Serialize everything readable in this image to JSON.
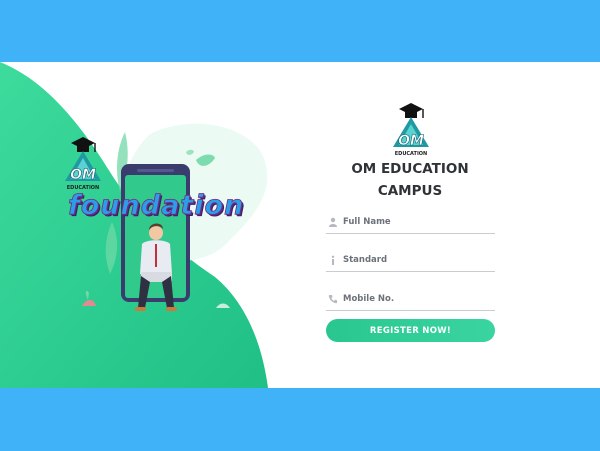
{
  "brand": {
    "logo_text": "OM",
    "logo_subtext": "EDUCATION",
    "title_line1": "OM EDUCATION",
    "title_line2": "CAMPUS"
  },
  "hero": {
    "word": "foundation"
  },
  "form": {
    "full_name": {
      "placeholder": "Full Name",
      "icon": "user-icon"
    },
    "standard": {
      "placeholder": "Standard",
      "icon": "info-icon"
    },
    "mobile": {
      "placeholder": "Mobile No.",
      "icon": "phone-icon"
    },
    "submit_label": "REGISTER NOW!"
  },
  "colors": {
    "background": "#3fb2f8",
    "accent": "#2ecc94",
    "text": "#2f3338"
  }
}
